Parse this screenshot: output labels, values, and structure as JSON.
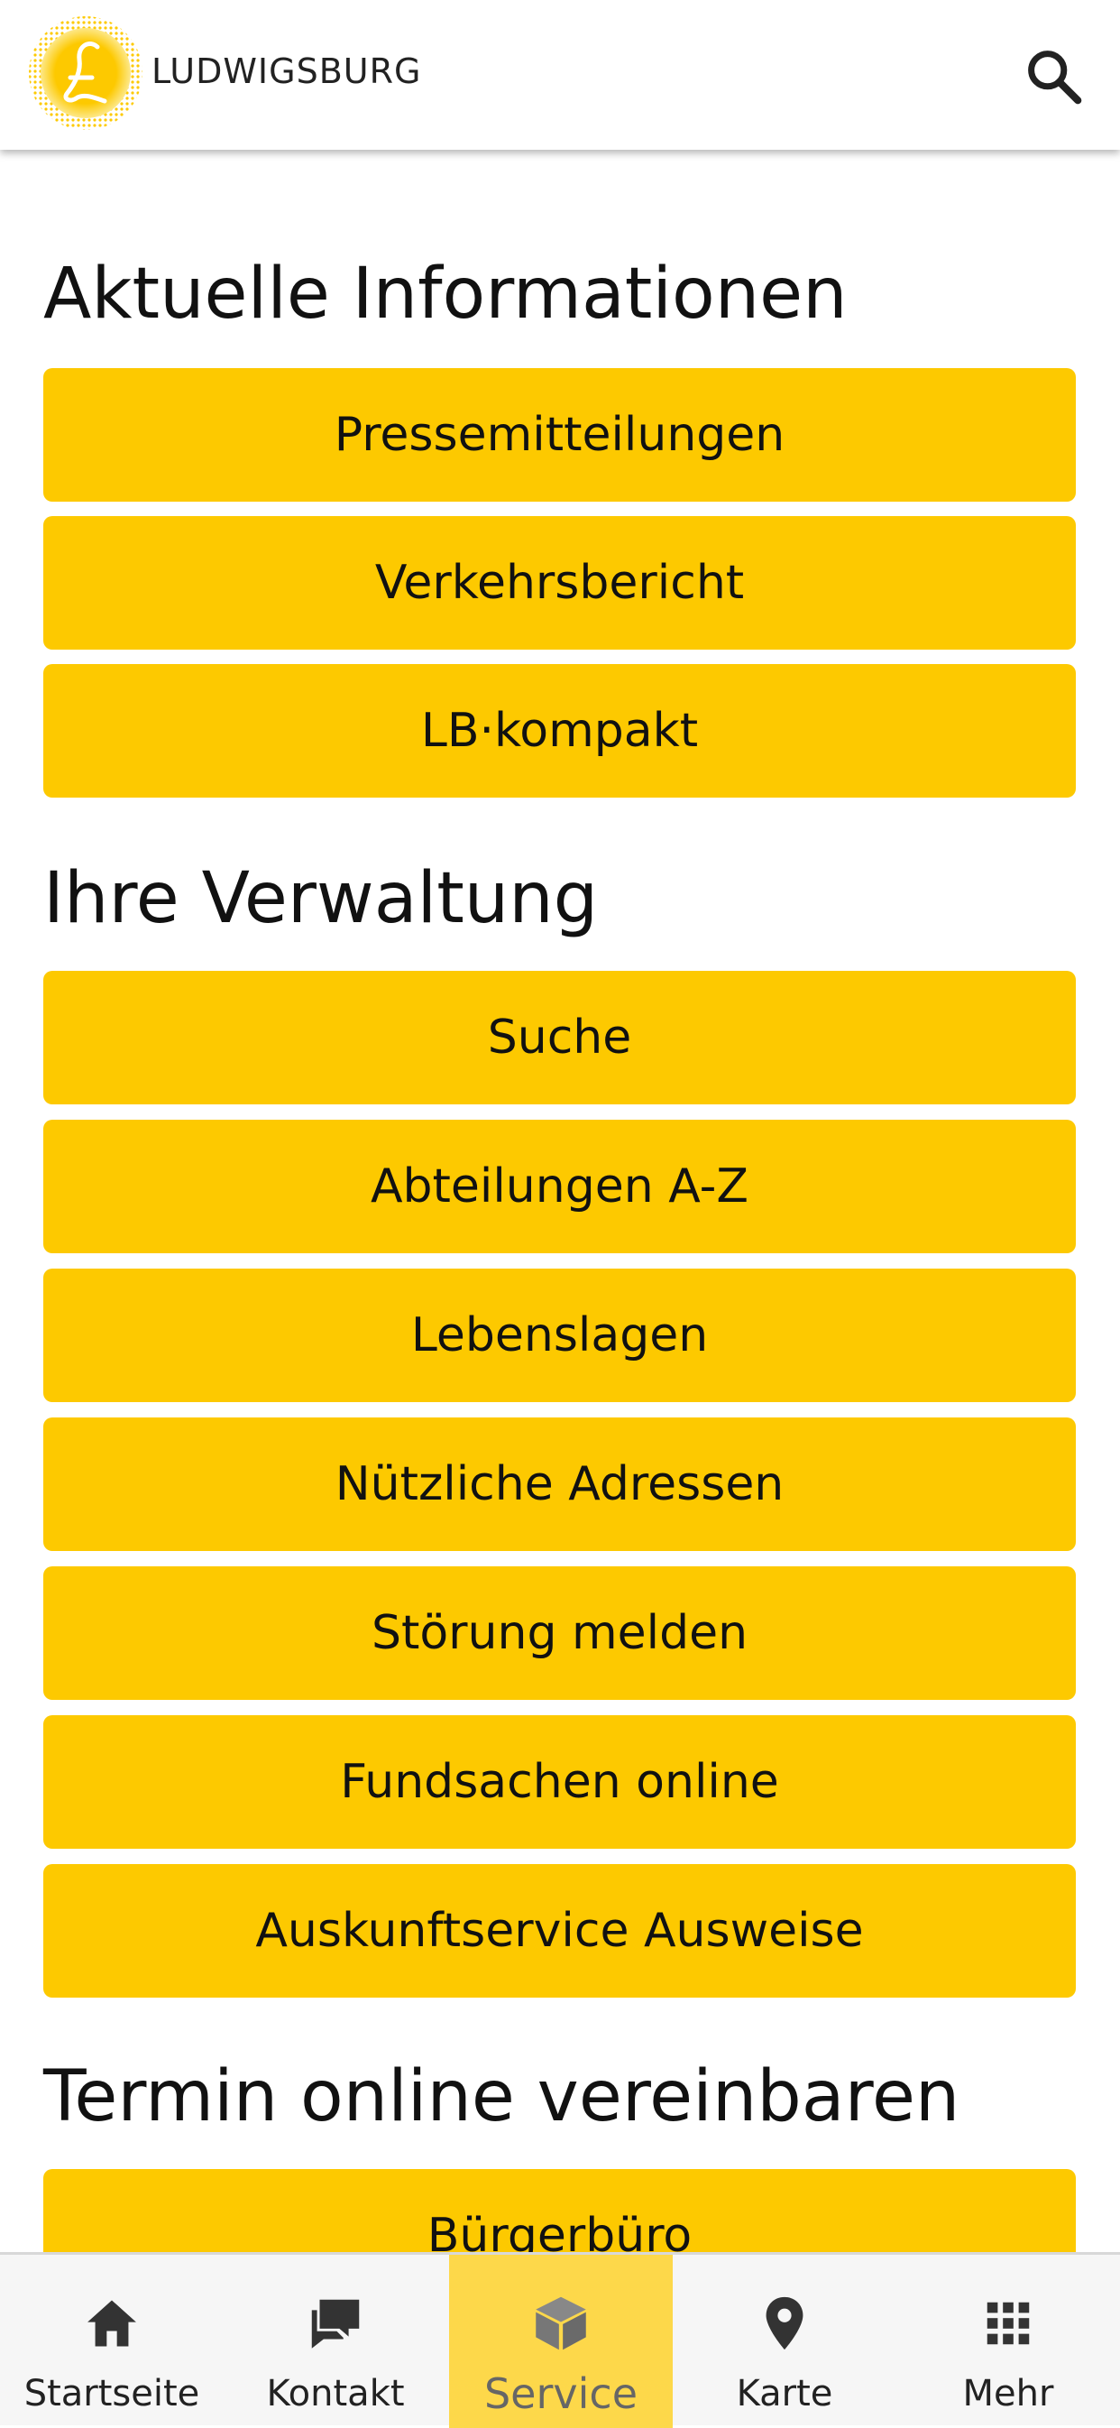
{
  "header": {
    "logo_text": "LUDWIGSBURG",
    "logo_icon": "ludwigsburg-l-emblem",
    "search_icon": "search-icon"
  },
  "colors": {
    "accent": "#fdc900",
    "active_tab": "#fdd84a",
    "tab_bar_bg": "#f6f6f6",
    "text": "#111111"
  },
  "sections": [
    {
      "title": "Aktuelle Informationen",
      "buttons": [
        "Pressemitteilungen",
        "Verkehrsbericht",
        "LB·kompakt"
      ]
    },
    {
      "title": "Ihre Verwaltung",
      "buttons": [
        "Suche",
        "Abteilungen A-Z",
        "Lebenslagen",
        "Nützliche Adressen",
        "Störung melden",
        "Fundsachen online",
        "Auskunftservice Ausweise"
      ]
    },
    {
      "title": "Termin online vereinbaren",
      "buttons": [
        "Bürgerbüro"
      ]
    }
  ],
  "tabbar": {
    "active": "Service",
    "items": [
      {
        "label": "Startseite",
        "icon": "home-icon"
      },
      {
        "label": "Kontakt",
        "icon": "chat-icon"
      },
      {
        "label": "Service",
        "icon": "box-icon"
      },
      {
        "label": "Karte",
        "icon": "map-pin-icon"
      },
      {
        "label": "Mehr",
        "icon": "grid-icon"
      }
    ]
  }
}
